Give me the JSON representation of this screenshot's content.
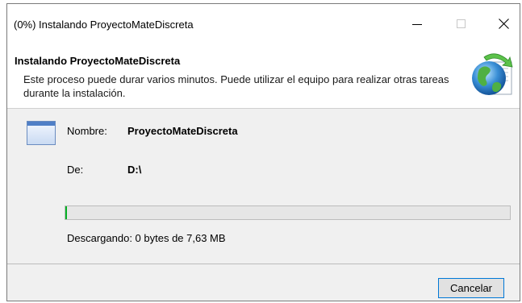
{
  "window": {
    "title": "(0%) Instalando ProyectoMateDiscreta"
  },
  "titlebar_buttons": {
    "minimize_icon": "minimize-icon",
    "maximize_icon": "maximize-icon",
    "close_icon": "close-icon"
  },
  "header": {
    "title": "Instalando ProyectoMateDiscreta",
    "description": "Este proceso puede durar varios minutos. Puede utilizar el equipo para realizar otras tareas durante la instalación.",
    "logo_icon": "globe-install-icon"
  },
  "details": {
    "app_icon": "application-window-icon",
    "name_label": "Nombre:",
    "name_value": "ProyectoMateDiscreta",
    "from_label": "De:",
    "from_value": "D:\\"
  },
  "progress": {
    "percent": 0,
    "fill_color": "#06b025",
    "status": "Descargando: 0 bytes de 7,63 MB"
  },
  "footer": {
    "cancel_label": "Cancelar",
    "accent_color": "#0078d7"
  }
}
